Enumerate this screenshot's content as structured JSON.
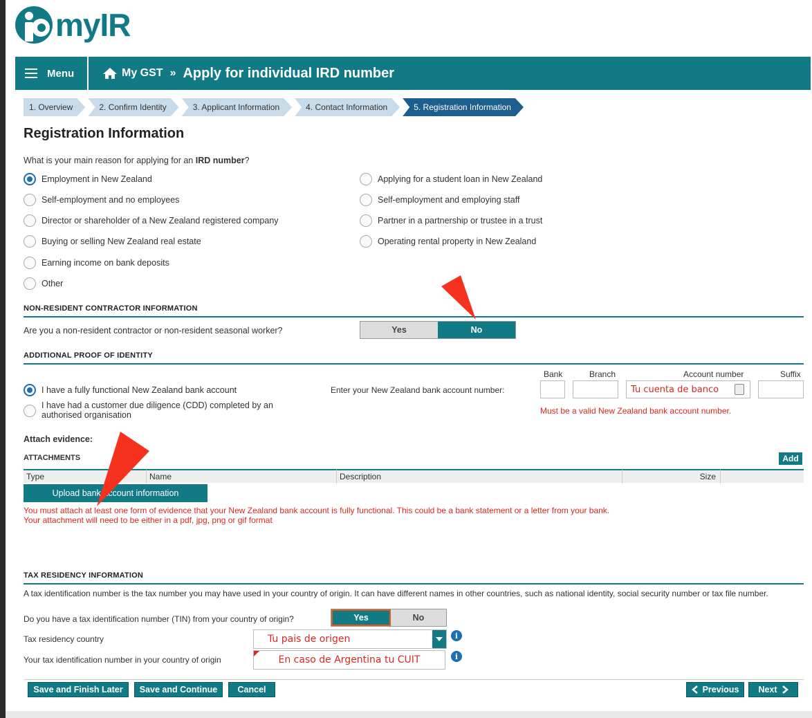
{
  "brand": {
    "name": "myIR"
  },
  "header": {
    "menu_label": "Menu",
    "breadcrumb_parent": "My GST",
    "breadcrumb_separator": "»",
    "page_title": "Apply for individual IRD number"
  },
  "steps": [
    {
      "label": "1. Overview",
      "active": false
    },
    {
      "label": "2. Confirm Identity",
      "active": false
    },
    {
      "label": "3. Applicant Information",
      "active": false
    },
    {
      "label": "4. Contact Information",
      "active": false
    },
    {
      "label": "5. Registration Information",
      "active": true
    }
  ],
  "section_title": "Registration Information",
  "reason": {
    "question_prefix": "What is your main reason for applying for an ",
    "question_bold": "IRD number",
    "question_suffix": "?",
    "left_options": [
      {
        "label": "Employment in New Zealand",
        "checked": true
      },
      {
        "label": "Self-employment and no employees",
        "checked": false
      },
      {
        "label": "Director or shareholder of a New Zealand registered company",
        "checked": false
      },
      {
        "label": "Buying or selling New Zealand real estate",
        "checked": false
      },
      {
        "label": "Earning income on bank deposits",
        "checked": false
      },
      {
        "label": "Other",
        "checked": false
      }
    ],
    "right_options": [
      {
        "label": "Applying for a student loan in New Zealand",
        "checked": false
      },
      {
        "label": "Self-employment and employing staff",
        "checked": false
      },
      {
        "label": "Partner in a partnership or trustee in a trust",
        "checked": false
      },
      {
        "label": "Operating rental property in New Zealand",
        "checked": false
      }
    ]
  },
  "non_resident": {
    "heading": "NON-RESIDENT CONTRACTOR INFORMATION",
    "question": "Are you a non-resident contractor or non-resident seasonal worker?",
    "yes_label": "Yes",
    "no_label": "No",
    "selected": "No"
  },
  "proof": {
    "heading": "ADDITIONAL PROOF OF IDENTITY",
    "option1": "I have a fully functional New Zealand bank account",
    "option2_line1": "I have had a customer due diligence (CDD) completed by an",
    "option2_line2": "authorised organisation",
    "bank_prompt": "Enter your New Zealand bank account number:",
    "col_bank": "Bank",
    "col_branch": "Branch",
    "col_account": "Account number",
    "col_suffix": "Suffix",
    "account_value": "Tu cuenta de banco",
    "error": "Must be a valid New Zealand bank account number."
  },
  "attachments": {
    "attach_label": "Attach evidence:",
    "heading": "ATTACHMENTS",
    "add_label": "Add",
    "columns": [
      "Type",
      "Name",
      "Description",
      "Size"
    ],
    "upload_label": "Upload bank account information",
    "error_line1": "You must attach at least one form of evidence that your New Zealand bank account is fully functional. This could be a bank statement or a letter from your bank.",
    "error_line2": "Your attachment will need to be either in a pdf, jpg, png or gif format"
  },
  "tax": {
    "heading": "TAX RESIDENCY INFORMATION",
    "description": "A tax identification number is the tax number you may have used in your country of origin. It can have different names in other countries, such as national identity, social security number or tax file number.",
    "tin_question": "Do you have a tax identification number (TIN) from your country of origin?",
    "yes_label": "Yes",
    "no_label": "No",
    "selected": "Yes",
    "country_label": "Tax residency country",
    "country_value": "Tu pais de origen",
    "tin_label": "Your tax identification number in your country of origin",
    "tin_value": "En caso de Argentina tu CUIT"
  },
  "footer": {
    "save_finish": "Save and Finish Later",
    "save_continue": "Save and Continue",
    "cancel": "Cancel",
    "previous": "Previous",
    "next": "Next"
  },
  "colors": {
    "brand_teal": "#117a84",
    "step_active": "#1c5f8c",
    "error_red": "#d9281f",
    "annotation_arrow": "#f5321e"
  }
}
